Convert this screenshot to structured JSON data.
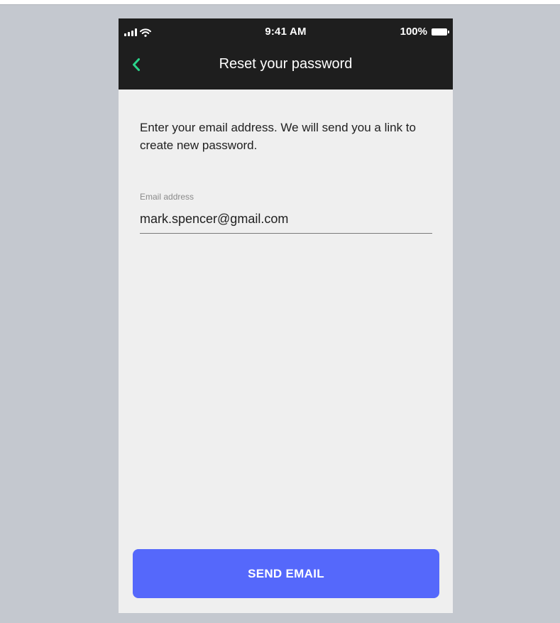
{
  "status_bar": {
    "time": "9:41 AM",
    "battery_percent": "100%",
    "icons": [
      "signal-icon",
      "wifi-icon",
      "battery-icon"
    ]
  },
  "nav": {
    "back_icon": "chevron-left-icon",
    "title": "Reset your password"
  },
  "main": {
    "instructions": "Enter your email address. We will send you a link to create new password.",
    "email_field": {
      "label": "Email address",
      "value": "mark.spencer@gmail.com"
    },
    "send_button_label": "SEND EMAIL"
  },
  "colors": {
    "accent_green": "#2bd48b",
    "header_bg": "#1e1e1e",
    "primary_button": "#5568fb",
    "content_bg": "#efefef",
    "backdrop": "#c4c8cf"
  }
}
